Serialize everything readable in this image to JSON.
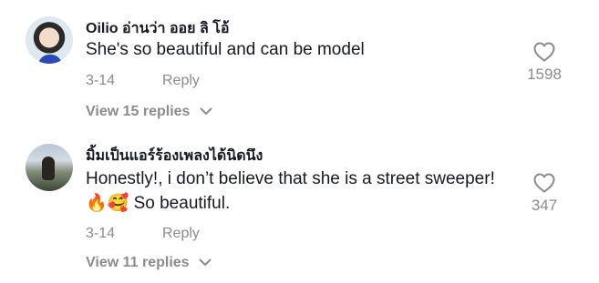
{
  "comments": [
    {
      "username": "Oilio อ่านว่า ออย ลิ โอ้",
      "text": "She's so beautiful and can be model",
      "date": "3-14",
      "reply_label": "Reply",
      "like_count": "1598",
      "view_replies": "View 15 replies"
    },
    {
      "username": "มิ้มเป็นแอร์ร้องเพลงได้นิดนึง",
      "text": "Honestly!, i don’t believe that she is a street sweeper!🔥🥰 So beautiful.",
      "date": "3-14",
      "reply_label": "Reply",
      "like_count": "347",
      "view_replies": "View 11 replies"
    }
  ],
  "icons": {
    "like": "heart-outline-icon",
    "expand": "chevron-down-icon"
  },
  "colors": {
    "primary_text": "#161823",
    "secondary_text": "#8a8b91"
  }
}
